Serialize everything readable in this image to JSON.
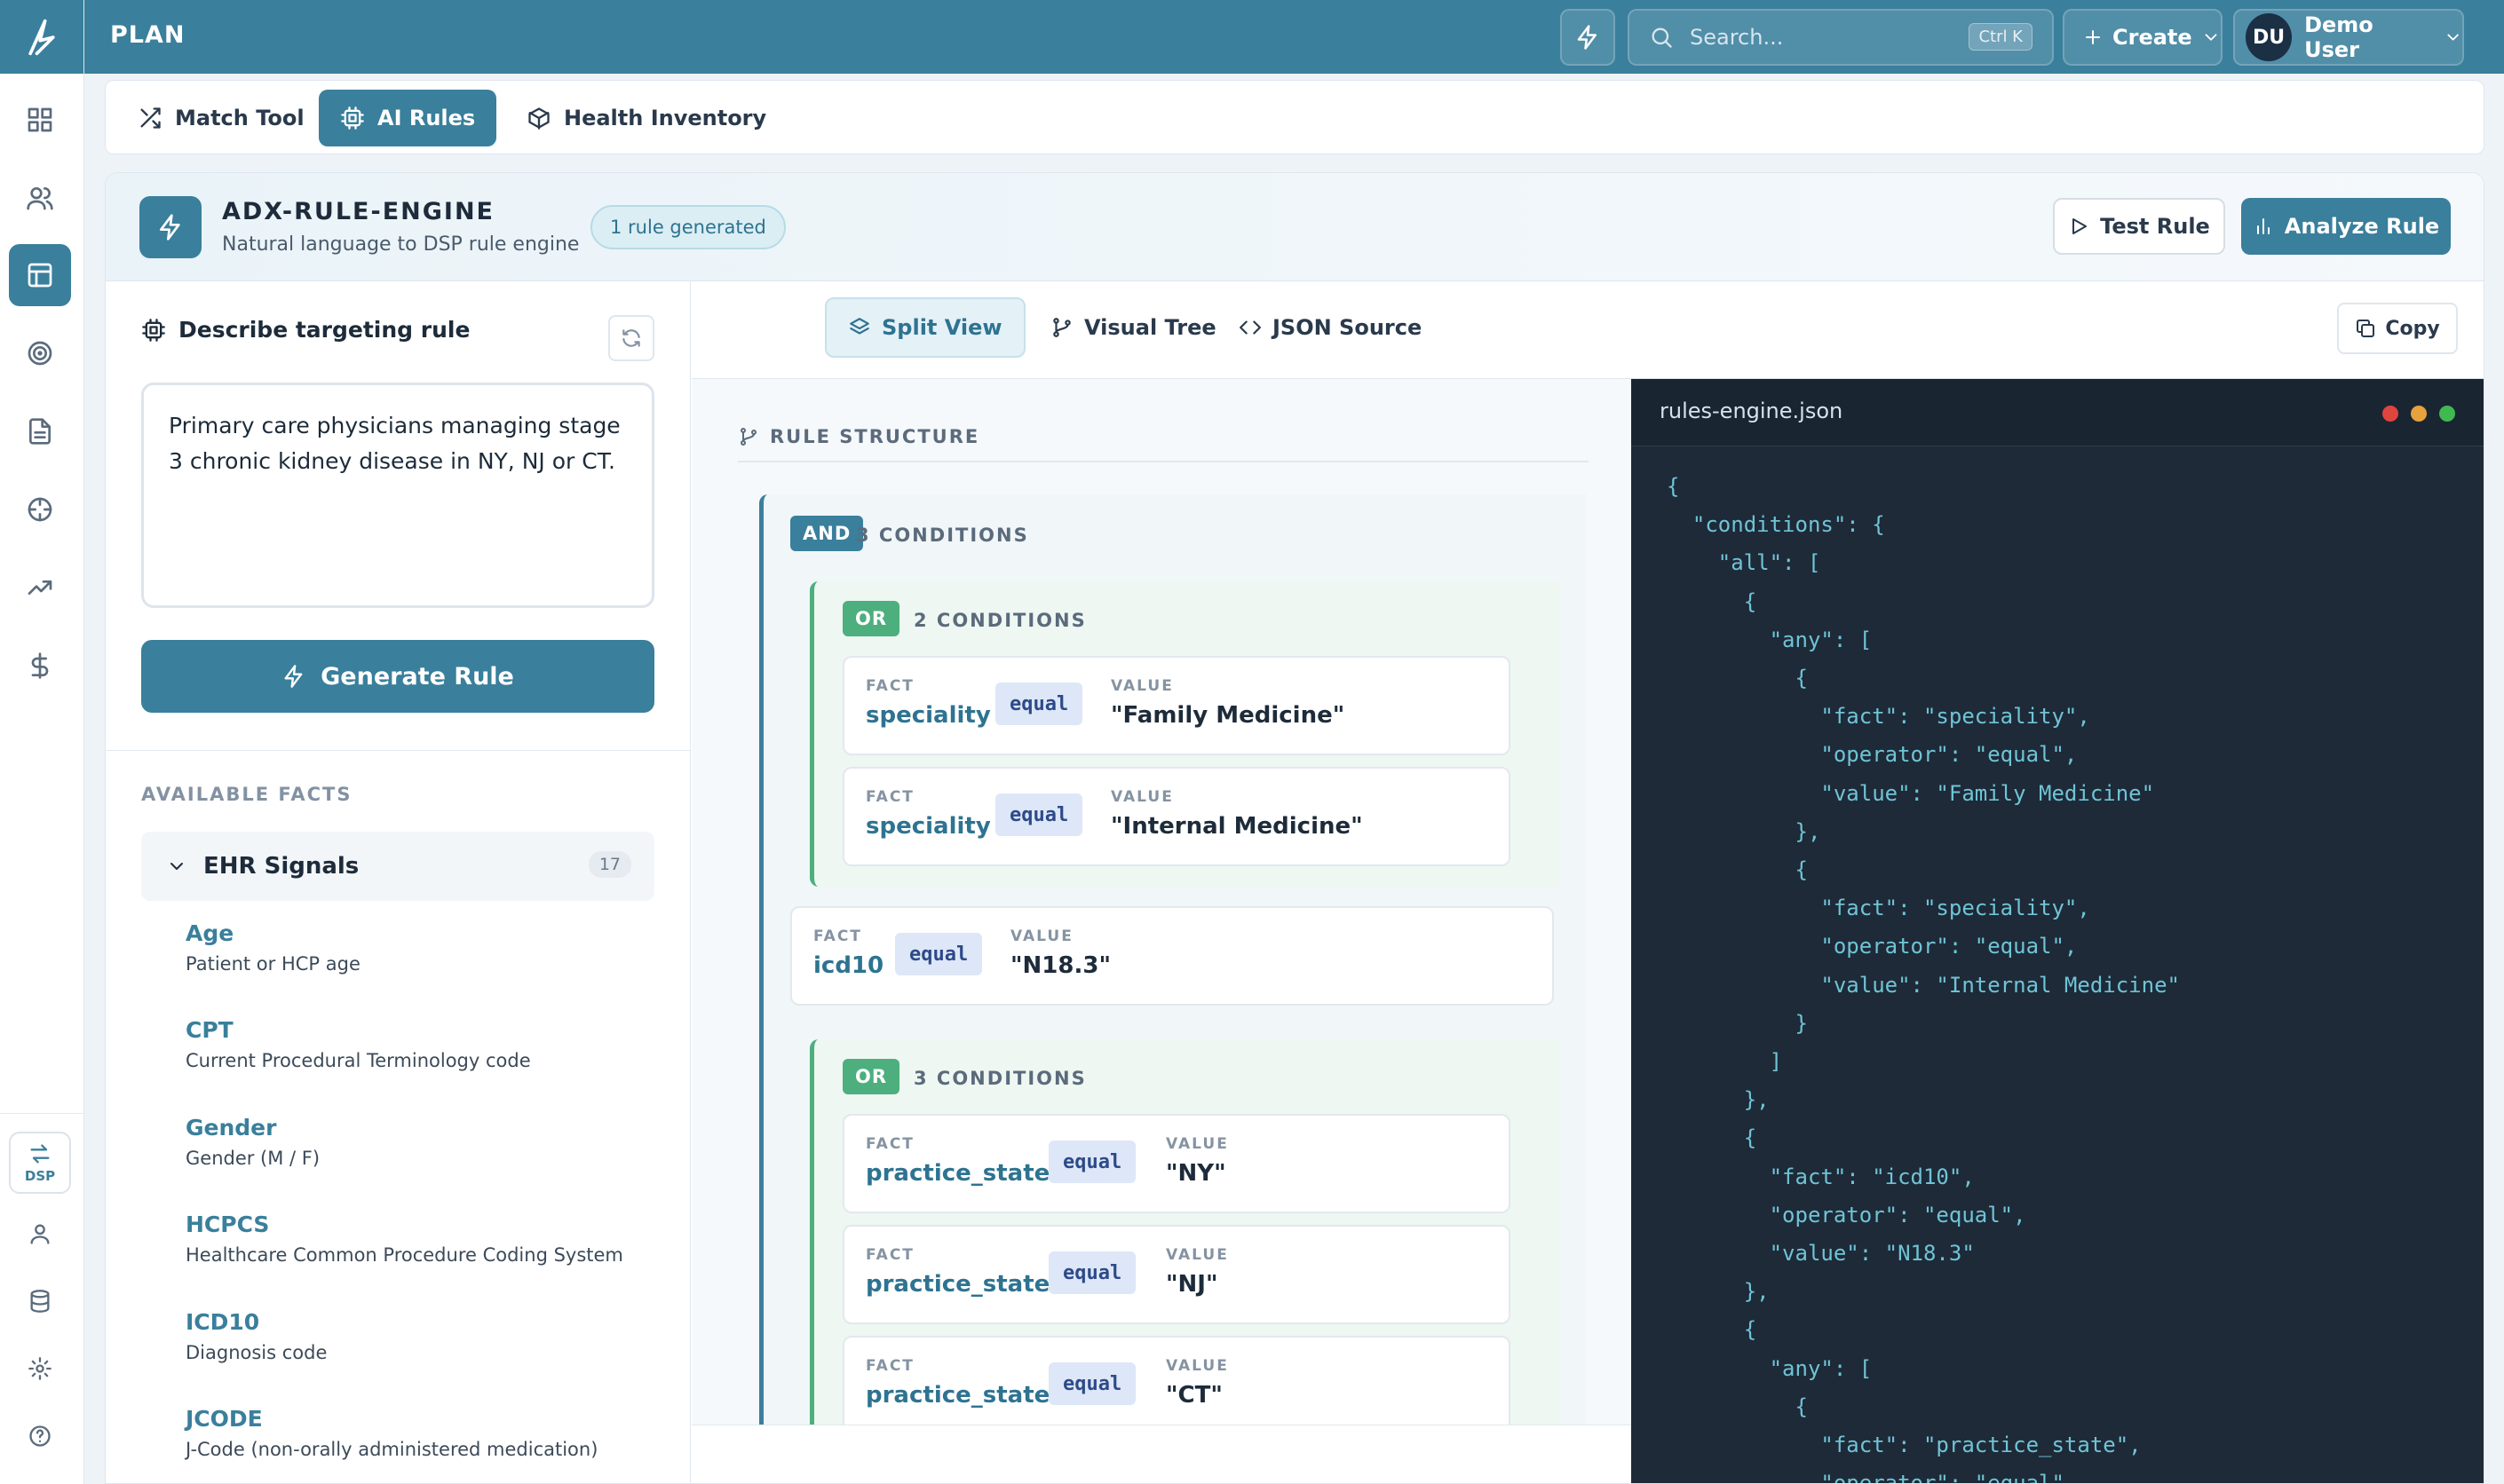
{
  "app": {
    "section_title": "PLAN"
  },
  "topbar": {
    "search_placeholder": "Search...",
    "search_shortcut": "Ctrl K",
    "create_label": "Create",
    "user_initials": "DU",
    "user_name": "Demo User"
  },
  "rail": {
    "dsp_label": "DSP"
  },
  "tabs": [
    {
      "label": "Match Tool",
      "active": false
    },
    {
      "label": "AI Rules",
      "active": true
    },
    {
      "label": "Health Inventory",
      "active": false
    }
  ],
  "engine": {
    "name": "ADX-RULE-ENGINE",
    "subtitle": "Natural language to DSP rule engine",
    "badge": "1 rule generated",
    "test_label": "Test Rule",
    "analyze_label": "Analyze Rule"
  },
  "describe": {
    "label": "Describe targeting rule",
    "prompt": "Primary care physicians managing stage 3 chronic kidney disease in NY, NJ or CT.",
    "generate_label": "Generate Rule"
  },
  "facts": {
    "title": "AVAILABLE FACTS",
    "group": {
      "name": "EHR Signals",
      "count": "17"
    },
    "items": [
      {
        "name": "Age",
        "desc": "Patient or HCP age"
      },
      {
        "name": "CPT",
        "desc": "Current Procedural Terminology code"
      },
      {
        "name": "Gender",
        "desc": "Gender (M / F)"
      },
      {
        "name": "HCPCS",
        "desc": "Healthcare Common Procedure Coding System"
      },
      {
        "name": "ICD10",
        "desc": "Diagnosis code"
      },
      {
        "name": "JCODE",
        "desc": "J-Code (non-orally administered medication)"
      }
    ]
  },
  "views": {
    "split": "Split View",
    "tree": "Visual Tree",
    "json": "JSON Source",
    "copy": "Copy"
  },
  "rule": {
    "heading": "RULE STRUCTURE",
    "fact_label": "FACT",
    "value_label": "VALUE",
    "root": {
      "op": "AND",
      "count": "3 CONDITIONS"
    },
    "group1": {
      "op": "OR",
      "count": "2 CONDITIONS",
      "conditions": [
        {
          "fact": "speciality",
          "operator": "equal",
          "value": "\"Family Medicine\""
        },
        {
          "fact": "speciality",
          "operator": "equal",
          "value": "\"Internal Medicine\""
        }
      ]
    },
    "single": {
      "fact": "icd10",
      "operator": "equal",
      "value": "\"N18.3\""
    },
    "group2": {
      "op": "OR",
      "count": "3 CONDITIONS",
      "conditions": [
        {
          "fact": "practice_state",
          "operator": "equal",
          "value": "\"NY\""
        },
        {
          "fact": "practice_state",
          "operator": "equal",
          "value": "\"NJ\""
        },
        {
          "fact": "practice_state",
          "operator": "equal",
          "value": "\"CT\""
        }
      ]
    }
  },
  "code": {
    "filename": "rules-engine.json",
    "source": "{\n  \"conditions\": {\n    \"all\": [\n      {\n        \"any\": [\n          {\n            \"fact\": \"speciality\",\n            \"operator\": \"equal\",\n            \"value\": \"Family Medicine\"\n          },\n          {\n            \"fact\": \"speciality\",\n            \"operator\": \"equal\",\n            \"value\": \"Internal Medicine\"\n          }\n        ]\n      },\n      {\n        \"fact\": \"icd10\",\n        \"operator\": \"equal\",\n        \"value\": \"N18.3\"\n      },\n      {\n        \"any\": [\n          {\n            \"fact\": \"practice_state\",\n            \"operator\": \"equal\""
  },
  "colors": {
    "brand": "#3a7f9c",
    "or_green": "#4caf7d",
    "code_bg": "#1e2a38"
  }
}
